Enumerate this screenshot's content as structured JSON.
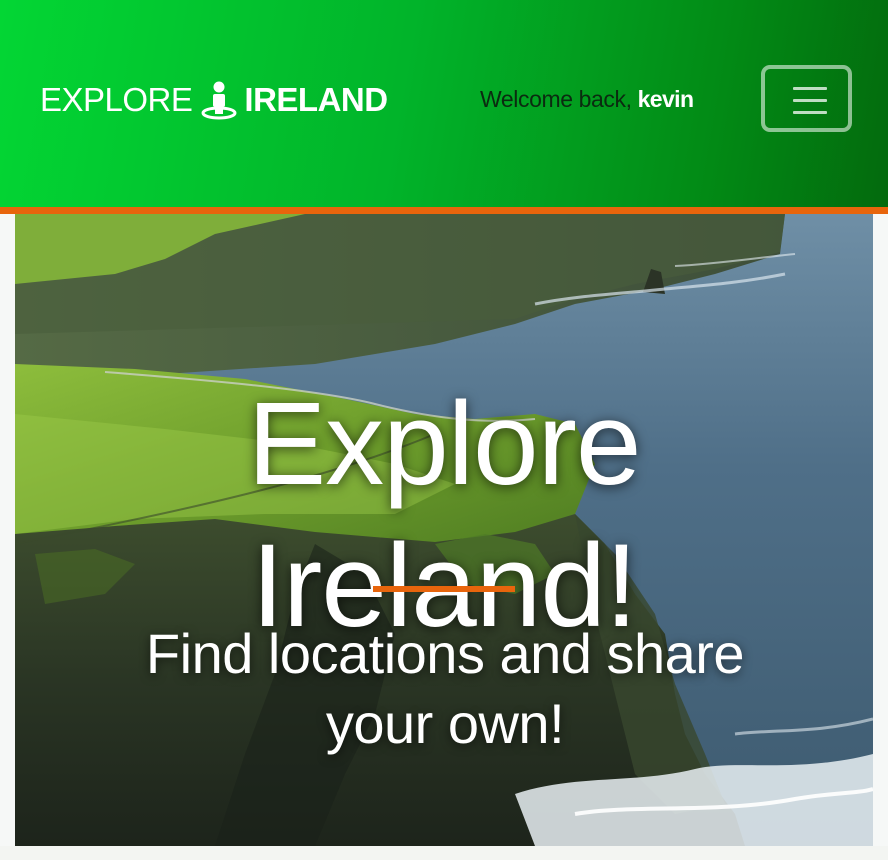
{
  "navbar": {
    "brand_light": "EXPLORE",
    "brand_bold": "IRELAND",
    "brand_icon": "person-pin-icon",
    "welcome_prefix": "Welcome back, ",
    "username": "kevin",
    "menu_icon": "hamburger-icon"
  },
  "hero": {
    "title_line1": "Explore",
    "title_line2": "Ireland!",
    "subtitle_line1": "Find locations and share",
    "subtitle_line2": "your own!"
  },
  "colors": {
    "nav_green_start": "#03d634",
    "nav_green_end": "#036a0d",
    "accent_orange": "#e8650c",
    "text_white": "#ffffff"
  }
}
